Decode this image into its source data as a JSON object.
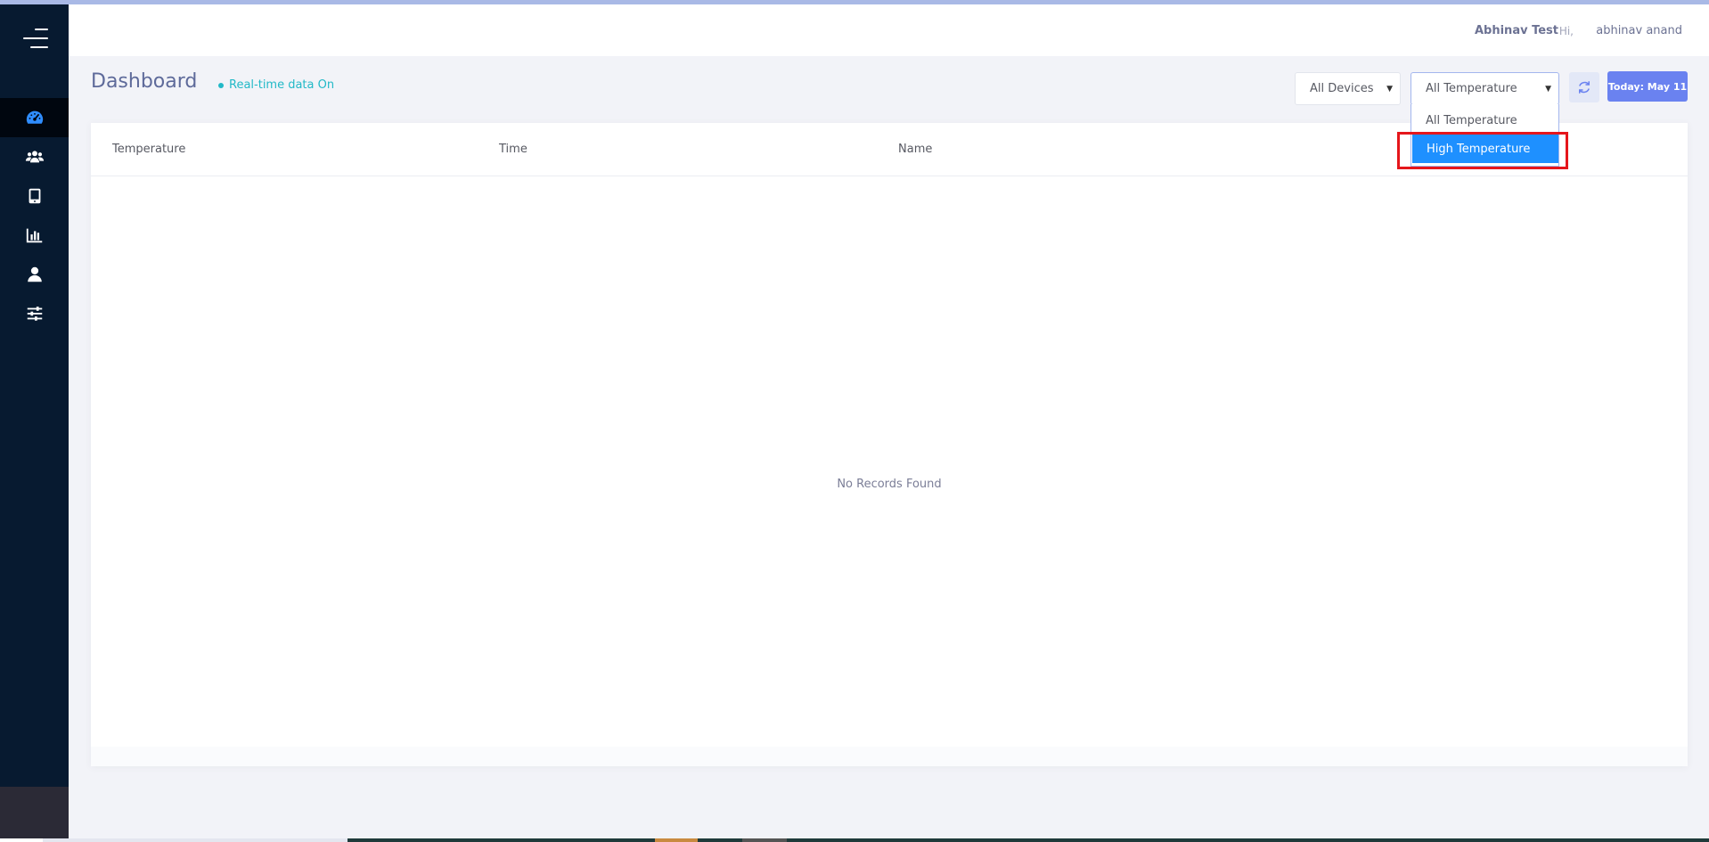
{
  "app": {
    "accent": "#6a82f0",
    "sidebar_bg": "#071a30"
  },
  "sidebar": {
    "menu_icon": "hamburger-menu-icon",
    "items": [
      {
        "icon": "dashboard-gauge-icon",
        "active": true
      },
      {
        "icon": "users-group-icon",
        "active": false
      },
      {
        "icon": "tablet-device-icon",
        "active": false
      },
      {
        "icon": "bar-chart-icon",
        "active": false
      },
      {
        "icon": "user-icon",
        "active": false
      },
      {
        "icon": "sliders-settings-icon",
        "active": false
      }
    ]
  },
  "header": {
    "company": "Abhinav Test",
    "greeting": "Hi,",
    "username": "abhinav anand"
  },
  "page": {
    "title": "Dashboard",
    "status": "Real-time data On"
  },
  "filters": {
    "devices_selected": "All Devices",
    "temperature_selected": "All Temperature",
    "temperature_options": [
      "All Temperature",
      "High Temperature"
    ],
    "highlighted_option": "High Temperature",
    "refresh_icon": "refresh-icon",
    "today_label": "Today: May 11"
  },
  "table": {
    "columns": [
      "Temperature",
      "Time",
      "Name"
    ],
    "empty_message": "No Records Found"
  }
}
